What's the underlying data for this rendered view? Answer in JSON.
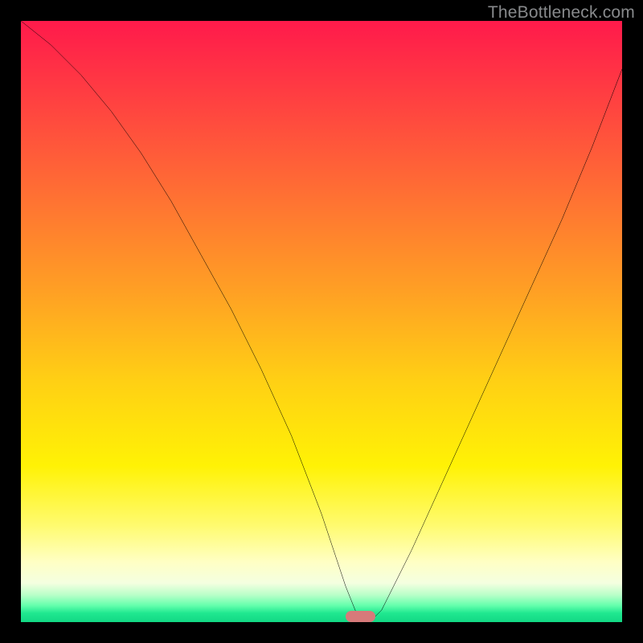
{
  "watermark": "TheBottleneck.com",
  "accent": {
    "curve_stroke": "#000000",
    "marker_fill": "#d77a7a",
    "frame_bg": "#000000"
  },
  "gradient_stops": [
    {
      "offset": 0.0,
      "color": "#ff1a4b"
    },
    {
      "offset": 0.12,
      "color": "#ff3d42"
    },
    {
      "offset": 0.28,
      "color": "#ff6d34"
    },
    {
      "offset": 0.45,
      "color": "#ffa024"
    },
    {
      "offset": 0.6,
      "color": "#ffd014"
    },
    {
      "offset": 0.74,
      "color": "#fff205"
    },
    {
      "offset": 0.84,
      "color": "#fffb70"
    },
    {
      "offset": 0.9,
      "color": "#ffffc4"
    },
    {
      "offset": 0.935,
      "color": "#f4ffe0"
    },
    {
      "offset": 0.955,
      "color": "#b8ffc8"
    },
    {
      "offset": 0.972,
      "color": "#66ffad"
    },
    {
      "offset": 0.985,
      "color": "#20e890"
    },
    {
      "offset": 1.0,
      "color": "#12d884"
    }
  ],
  "chart_data": {
    "type": "line",
    "title": "",
    "xlabel": "",
    "ylabel": "",
    "xlim": [
      0,
      100
    ],
    "ylim": [
      0,
      100
    ],
    "grid": false,
    "legend": false,
    "marker": {
      "x_center": 56.5,
      "width": 5,
      "y": 0
    },
    "series": [
      {
        "name": "bottleneck-curve",
        "x": [
          0,
          5,
          10,
          15,
          20,
          25,
          30,
          35,
          40,
          45,
          50,
          52,
          54,
          56,
          58,
          60,
          62,
          65,
          70,
          75,
          80,
          85,
          90,
          95,
          100
        ],
        "values": [
          100,
          96,
          91,
          85,
          78,
          70,
          61,
          52,
          42,
          31,
          18,
          12,
          6,
          1,
          0,
          2,
          6,
          12,
          23,
          34,
          45,
          56,
          67,
          79,
          92
        ]
      }
    ]
  }
}
